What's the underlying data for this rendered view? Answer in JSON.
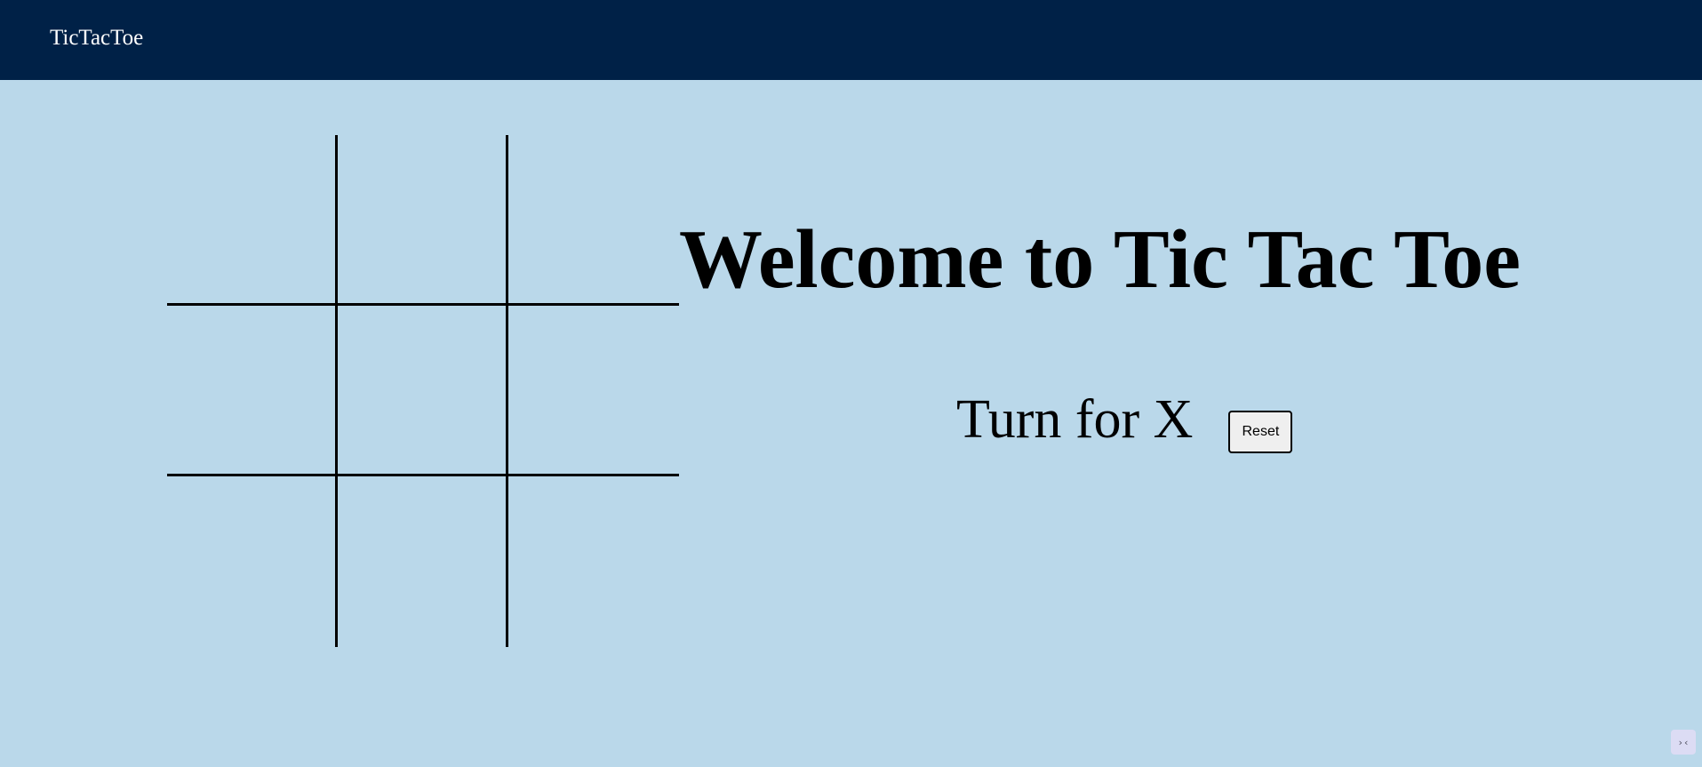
{
  "navbar": {
    "brand": "TicTacToe",
    "background": "#002147"
  },
  "board": {
    "cells": [
      "",
      "",
      "",
      "",
      "",
      "",
      "",
      "",
      ""
    ]
  },
  "main": {
    "heading": "Welcome to Tic Tac Toe",
    "status": "Turn for X",
    "reset_label": "Reset"
  },
  "corner_widget": {
    "icon": "collapse-icon",
    "glyph": "›‹"
  },
  "colors": {
    "page_background": "#bad8ea",
    "grid_lines": "#000000"
  }
}
